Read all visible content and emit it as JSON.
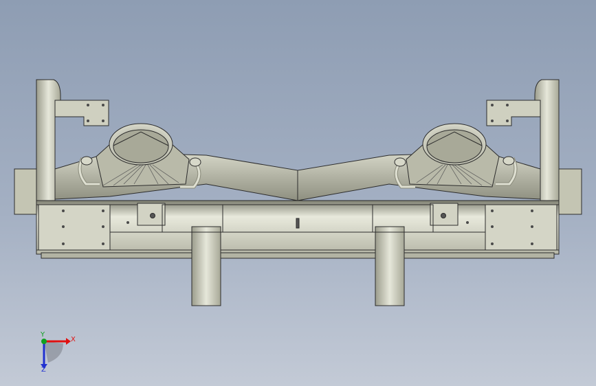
{
  "viewport": {
    "background_top": "#8e9db3",
    "background_bottom": "#c3cad6"
  },
  "model": {
    "part_fill": "#c9cab8",
    "part_fill_dark": "#9c9d8c",
    "part_fill_light": "#e4e5d8",
    "edge_color": "#2b2b2b"
  },
  "triad": {
    "x_label": "X",
    "y_label": "Y",
    "z_label": "Z",
    "x_color": "#e01010",
    "y_color": "#10a020",
    "z_color": "#2030d0"
  }
}
